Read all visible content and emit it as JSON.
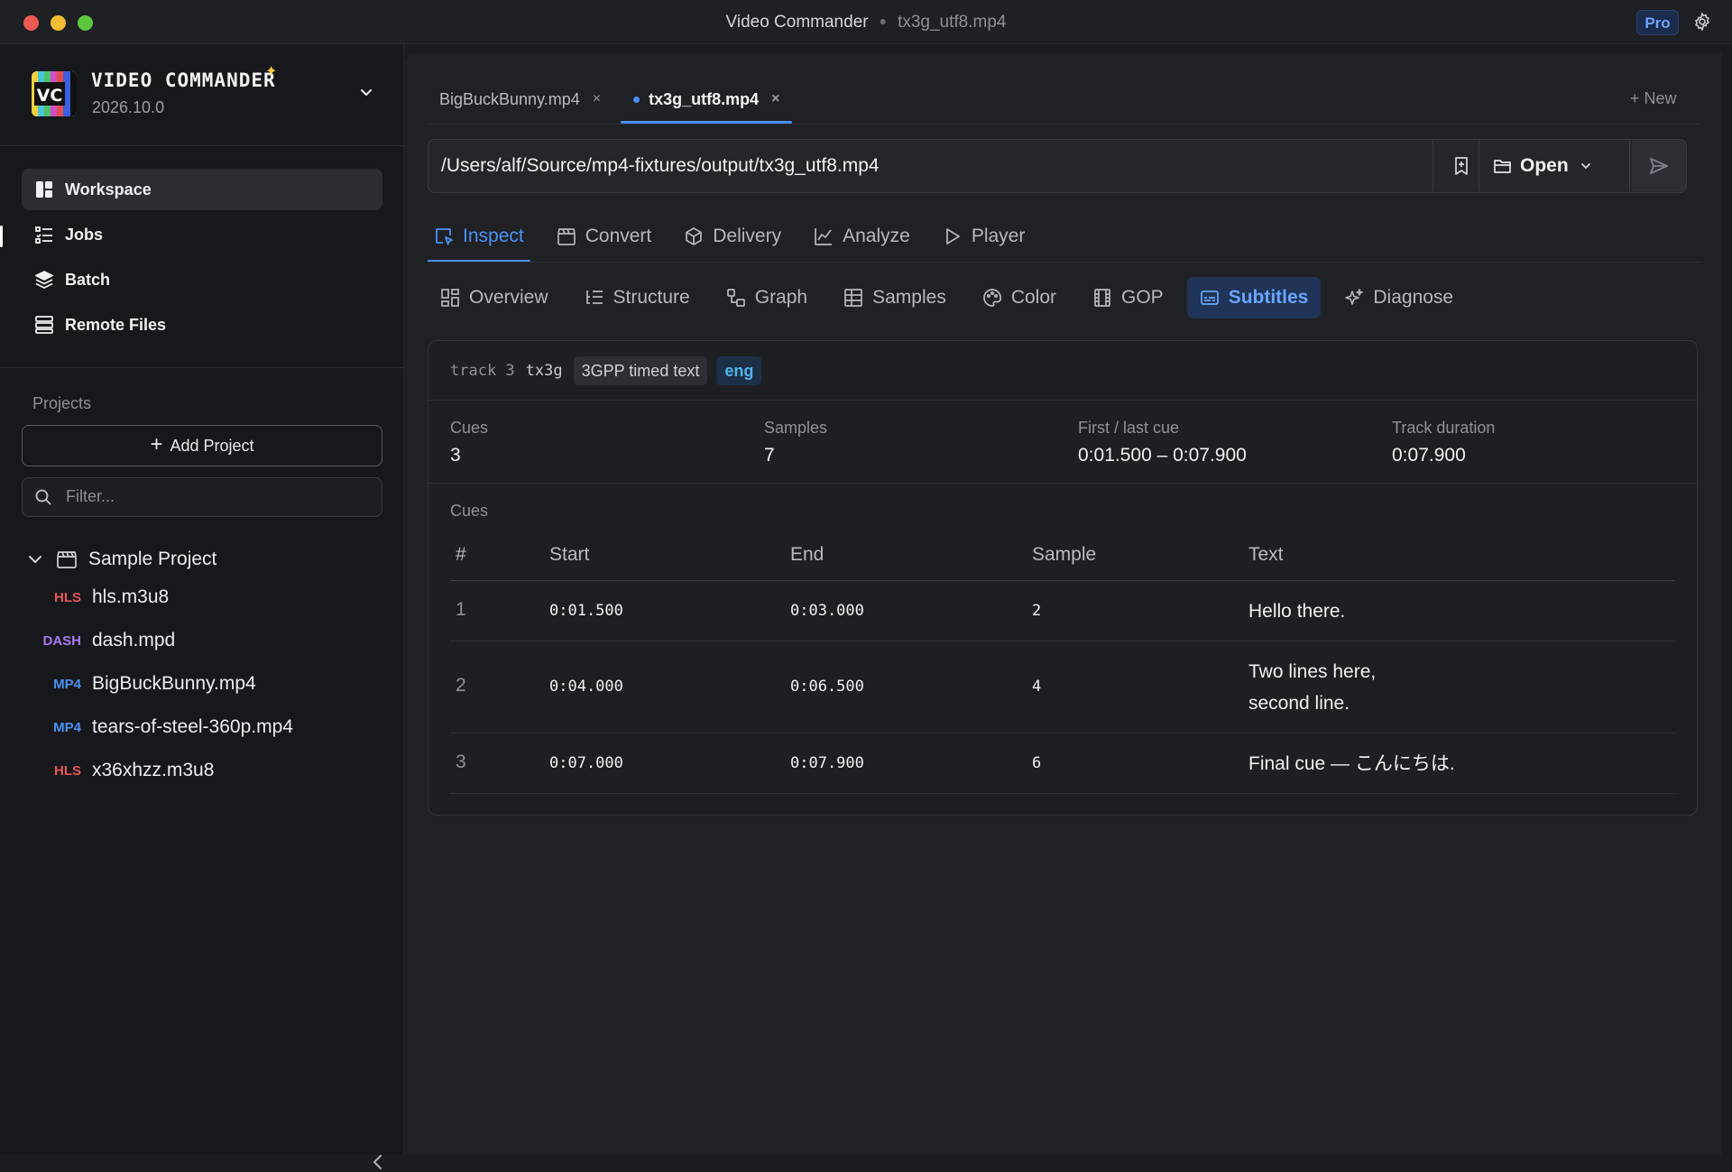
{
  "titlebar": {
    "app": "Video Commander",
    "file": "tx3g_utf8.mp4",
    "pro": "Pro"
  },
  "brand": {
    "name": "VIDEO COMMANDER",
    "version": "2026.10.0",
    "logo_text": "VC"
  },
  "nav": [
    {
      "label": "Workspace",
      "icon": "grid-icon",
      "active": true
    },
    {
      "label": "Jobs",
      "icon": "list-icon"
    },
    {
      "label": "Batch",
      "icon": "layers-icon"
    },
    {
      "label": "Remote Files",
      "icon": "server-icon"
    }
  ],
  "projects": {
    "label": "Projects",
    "add": "Add Project",
    "filter_placeholder": "Filter...",
    "root": "Sample Project",
    "files": [
      {
        "type": "HLS",
        "name": "hls.m3u8"
      },
      {
        "type": "DASH",
        "name": "dash.mpd"
      },
      {
        "type": "MP4",
        "name": "BigBuckBunny.mp4"
      },
      {
        "type": "MP4",
        "name": "tears-of-steel-360p.mp4"
      },
      {
        "type": "HLS",
        "name": "x36xhzz.m3u8"
      }
    ]
  },
  "filetabs": [
    {
      "label": "BigBuckBunny.mp4",
      "close": "×"
    },
    {
      "label": "tx3g_utf8.mp4",
      "close": "×",
      "active": true
    }
  ],
  "new_tab": "+ New",
  "path": {
    "value": "/Users/alf/Source/mp4-fixtures/output/tx3g_utf8.mp4",
    "open": "Open"
  },
  "modetabs": [
    {
      "label": "Inspect",
      "active": true
    },
    {
      "label": "Convert"
    },
    {
      "label": "Delivery"
    },
    {
      "label": "Analyze"
    },
    {
      "label": "Player"
    }
  ],
  "subtabs": [
    {
      "label": "Overview"
    },
    {
      "label": "Structure"
    },
    {
      "label": "Graph"
    },
    {
      "label": "Samples"
    },
    {
      "label": "Color"
    },
    {
      "label": "GOP"
    },
    {
      "label": "Subtitles",
      "active": true
    },
    {
      "label": "Diagnose"
    }
  ],
  "track": {
    "id": "track 3",
    "codec": "tx3g",
    "format": "3GPP timed text",
    "lang": "eng",
    "stats": [
      {
        "label": "Cues",
        "value": "3"
      },
      {
        "label": "Samples",
        "value": "7"
      },
      {
        "label": "First / last cue",
        "value": "0:01.500 – 0:07.900"
      },
      {
        "label": "Track duration",
        "value": "0:07.900"
      }
    ]
  },
  "cues": {
    "label": "Cues",
    "headers": [
      "#",
      "Start",
      "End",
      "Sample",
      "Text"
    ],
    "rows": [
      {
        "num": "1",
        "start": "0:01.500",
        "end": "0:03.000",
        "sample": "2",
        "text": [
          "Hello there."
        ]
      },
      {
        "num": "2",
        "start": "0:04.000",
        "end": "0:06.500",
        "sample": "4",
        "text": [
          "Two lines here,",
          "second line."
        ]
      },
      {
        "num": "3",
        "start": "0:07.000",
        "end": "0:07.900",
        "sample": "6",
        "text": [
          "Final cue — こんにちは."
        ]
      }
    ]
  },
  "colors": {
    "accent": "#4a8ff5",
    "hls": "#e4565b",
    "dash": "#a779f2",
    "mp4": "#4a92f5"
  }
}
